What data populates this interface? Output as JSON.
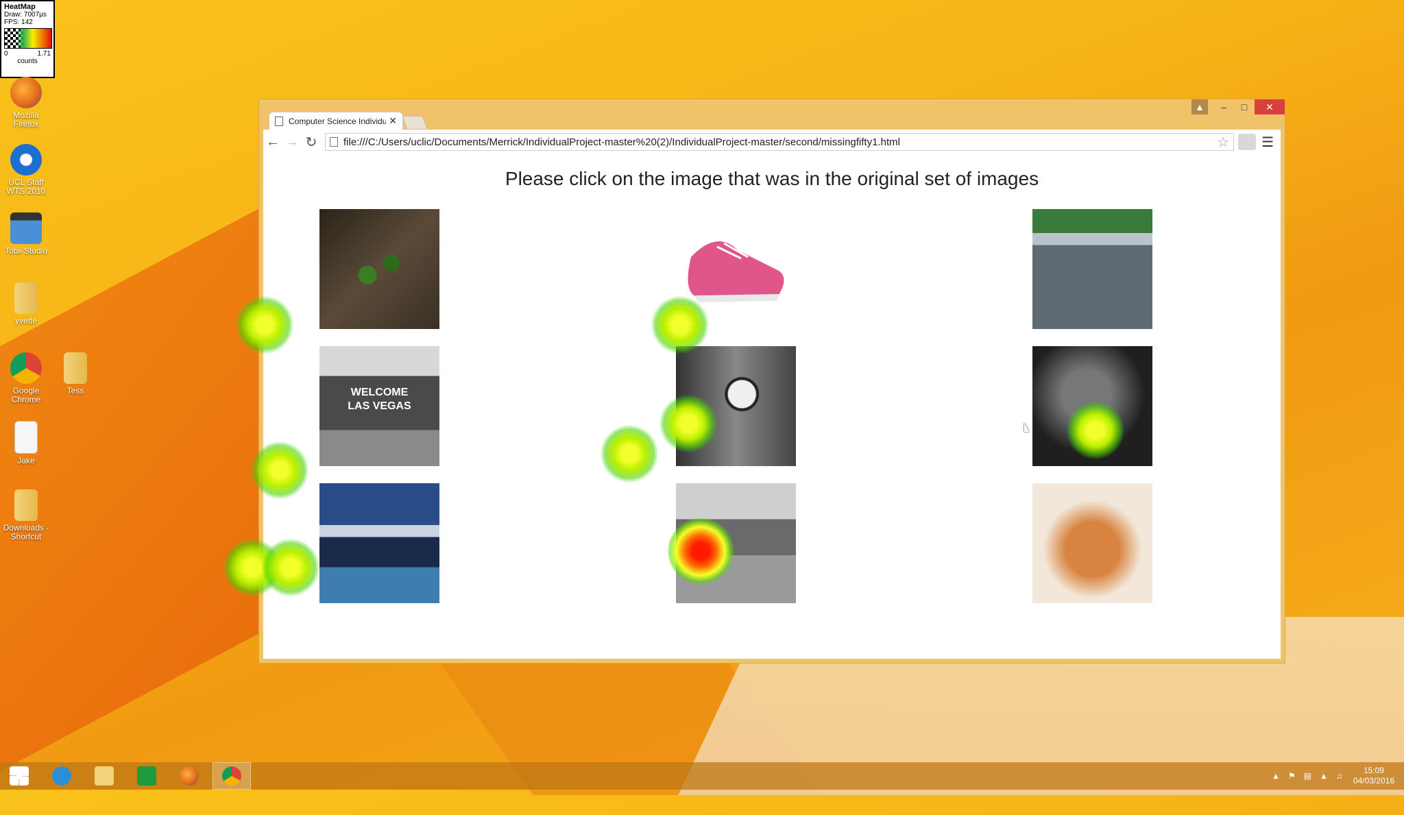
{
  "heatmap_legend": {
    "title": "HeatMap",
    "draw": "Draw: 7007µs",
    "fps": "FPS: 142",
    "min": "0",
    "max": "1.71",
    "unit": "counts"
  },
  "desktop_icons": [
    {
      "label": "Mozilla Firefox",
      "icon": "firefox-icon",
      "color": "#e0661c"
    },
    {
      "label": "UCL Staff WTS 2010",
      "icon": "remote-desktop-icon",
      "color": "#1c6fd1"
    },
    {
      "label": "Tobii Studio",
      "icon": "tobii-studio-icon",
      "color": "#4c8fd9"
    },
    {
      "label": "yvette",
      "icon": "folder-icon",
      "color": "#f2d27a"
    },
    {
      "label": "Google Chrome",
      "icon": "chrome-icon",
      "color": "#2f9c3c"
    },
    {
      "label": "Tess",
      "icon": "folder-icon",
      "color": "#f2d27a"
    },
    {
      "label": "Jake",
      "icon": "document-icon",
      "color": "#f0f0f0"
    },
    {
      "label": "Downloads - Shortcut",
      "icon": "downloads-folder-icon",
      "color": "#f2d27a"
    }
  ],
  "browser": {
    "tab_title": "Computer Science Individu",
    "url": "file:///C:/Users/uclic/Documents/Merrick/IndividualProject-master%20(2)/IndividualProject-master/second/missingfifty1.html"
  },
  "page": {
    "prompt": "Please click on the image that was in the original set of images",
    "images": [
      {
        "name": "image-beetle"
      },
      {
        "name": "image-shoe"
      },
      {
        "name": "image-go-karts"
      },
      {
        "name": "image-las-vegas"
      },
      {
        "name": "image-lemur"
      },
      {
        "name": "image-bw-closeup"
      },
      {
        "name": "image-ship"
      },
      {
        "name": "image-bw-landscape"
      },
      {
        "name": "image-gingerbread-house"
      }
    ],
    "vegas_sign": "WELCOME LAS VEGAS"
  },
  "taskbar": {
    "apps": [
      "windows-start-icon",
      "internet-explorer-icon",
      "file-explorer-icon",
      "store-icon",
      "firefox-icon",
      "chrome-icon"
    ],
    "active_app": "chrome-icon",
    "time": "15:09",
    "date": "04/03/2016"
  },
  "colors": {
    "accent_close": "#d9403a",
    "heat_low": "#46d200",
    "heat_mid": "#f3ff2a",
    "heat_high": "#ff1a00"
  }
}
